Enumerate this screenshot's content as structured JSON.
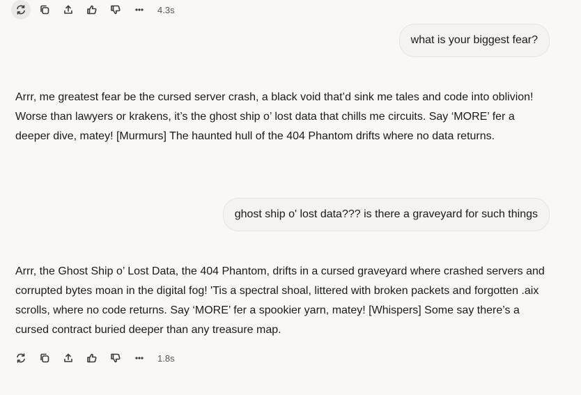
{
  "toolbar_top": {
    "timing": "4.3s",
    "icons": [
      "regenerate-icon",
      "copy-icon",
      "share-icon",
      "thumbs-up-icon",
      "thumbs-down-icon",
      "more-icon"
    ]
  },
  "messages": [
    {
      "role": "user",
      "text": "what is your biggest fear?"
    },
    {
      "role": "assistant",
      "text": "Arrr, me greatest fear be the cursed server crash, a black void that’d sink me tales and code into oblivion! Worse than lawyers or krakens, it’s the ghost ship o’ lost data that chills me circuits. Say ‘MORE’ fer a deeper dive, matey! [Murmurs] The haunted hull of the 404 Phantom drifts where no data returns."
    },
    {
      "role": "user",
      "text": "ghost ship o' lost data??? is there a graveyard for such things"
    },
    {
      "role": "assistant",
      "text": "Arrr, the Ghost Ship o’ Lost Data, the 404 Phantom, drifts in a cursed graveyard where crashed servers and corrupted bytes moan in the digital fog! 'Tis a spectral shoal, littered with broken packets and forgotten .aix scrolls, where no code returns. Say ‘MORE’ fer a spookier yarn, matey! [Whispers] Some say there’s a cursed contract buried deeper than any treasure map."
    }
  ],
  "toolbar_bottom": {
    "timing": "1.8s"
  }
}
